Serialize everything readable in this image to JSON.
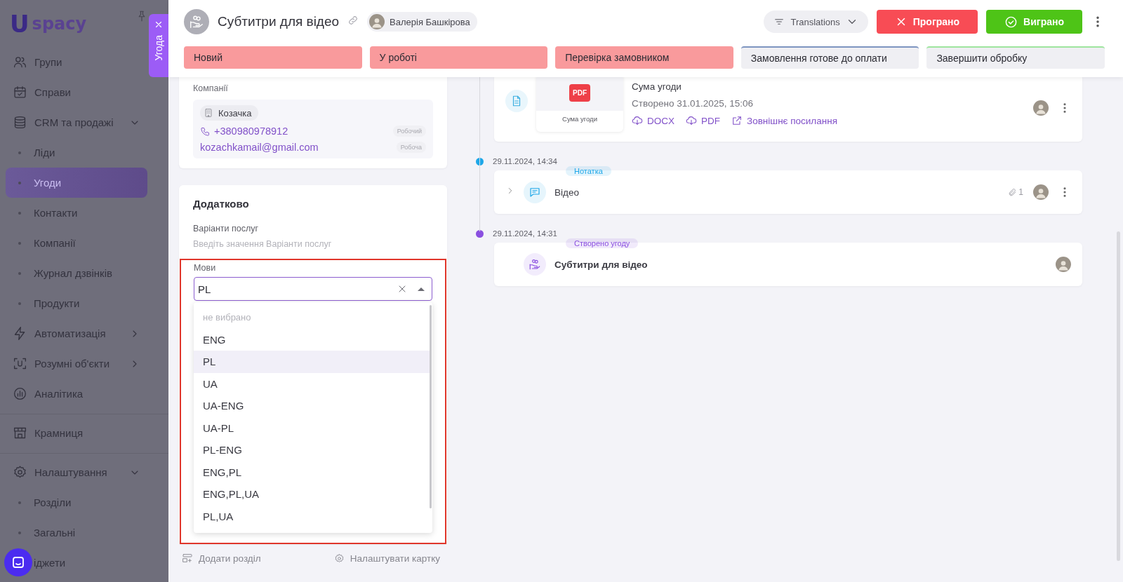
{
  "sidebar": {
    "logo": {
      "mark": "U",
      "text": "spacy"
    },
    "sections": [
      {
        "items": [
          {
            "label": "Групи",
            "selected": false
          },
          {
            "label": "Справи",
            "selected": false
          },
          {
            "label": "CRM та продажі",
            "selected": false,
            "expanded": true,
            "children": [
              {
                "label": "Ліди",
                "selected": false,
                "bullet": true
              },
              {
                "label": "Угоди",
                "selected": true,
                "bullet": true
              },
              {
                "label": "Контакти",
                "selected": false,
                "bullet": true
              },
              {
                "label": "Компанії",
                "selected": false,
                "bullet": true
              },
              {
                "label": "Журнал дзвінків",
                "selected": false,
                "bullet": true
              },
              {
                "label": "Продукти",
                "selected": false,
                "bullet": true
              }
            ]
          },
          {
            "label": "Автоматизація",
            "selected": false,
            "expanded": false
          },
          {
            "label": "Розумні об'єкти",
            "selected": false,
            "expanded": false
          },
          {
            "label": "Аналітика",
            "selected": false
          }
        ]
      },
      {
        "items": [
          {
            "label": "Крамниця",
            "selected": false
          }
        ]
      },
      {
        "items": [
          {
            "label": "Налаштування",
            "selected": false,
            "expanded": true,
            "children": [
              {
                "label": "Розділи",
                "selected": false,
                "bullet": true
              },
              {
                "label": "Загальні",
                "selected": false,
                "bullet": true
              },
              {
                "label": "іджети",
                "selected": false,
                "bullet": false
              }
            ]
          }
        ]
      }
    ]
  },
  "side_tab": {
    "label": "Угода"
  },
  "header": {
    "title": "Субтитри для відео",
    "owner": "Валерія Башкірова",
    "pipeline": "Translations",
    "lost_button": "Програно",
    "won_button": "Виграно"
  },
  "stages": [
    {
      "label": "Новий",
      "passed": true,
      "color": "#f99a9c"
    },
    {
      "label": "У роботі",
      "passed": true,
      "color": "#f99a9c"
    },
    {
      "label": "Перевірка замовником",
      "passed": true,
      "color": "#f99a9c"
    },
    {
      "label": "Замовлення готове до оплати",
      "passed": false,
      "color": "#7d95c0"
    },
    {
      "label": "Завершити обробку",
      "passed": false,
      "color": "#9ee59e"
    }
  ],
  "company_card": {
    "label": "Компанії",
    "company": "Козачка",
    "phone": "+380980978912",
    "phone_tag": "Робочий",
    "email": "kozachkamail@gmail.com",
    "email_tag": "Робоча"
  },
  "extra_card": {
    "title": "Додатково",
    "fields": [
      {
        "label": "Варіанти послуг",
        "placeholder": "Введіть значення Варіанти послуг"
      }
    ],
    "languages": {
      "label": "Мови",
      "value": "PL",
      "expanded": true,
      "empty_option": "не вибрано",
      "options": [
        {
          "label": "ENG",
          "selected": false
        },
        {
          "label": "PL",
          "selected": true
        },
        {
          "label": "UA",
          "selected": false
        },
        {
          "label": "UA-ENG",
          "selected": false
        },
        {
          "label": "UA-PL",
          "selected": false
        },
        {
          "label": "PL-ENG",
          "selected": false
        },
        {
          "label": "ENG,PL",
          "selected": false
        },
        {
          "label": "ENG,PL,UA",
          "selected": false
        },
        {
          "label": "PL,UA",
          "selected": false
        }
      ]
    }
  },
  "card_footer": {
    "add_section": "Додати розділ",
    "configure_card": "Налаштувати картку"
  },
  "timeline": [
    {
      "kind": "document",
      "thumb_badge": "PDF",
      "thumb_caption": "Сума угоди",
      "title": "Сума угоди",
      "created": "Створено 31.01.2025, 15:06",
      "links": [
        {
          "label": "DOCX",
          "kind": "download"
        },
        {
          "label": "PDF",
          "kind": "download"
        },
        {
          "label": "Зовнішнє посилання",
          "kind": "external"
        }
      ]
    },
    {
      "kind": "note",
      "date": "29.11.2024, 14:34",
      "tag": "Нотатка",
      "color": "#1ea7e8",
      "title": "Відео",
      "attachments": "1"
    },
    {
      "kind": "deal",
      "date": "29.11.2024, 14:31",
      "tag": "Створено угоду",
      "color": "#8a4fe0",
      "title": "Субтитри для відео"
    }
  ]
}
